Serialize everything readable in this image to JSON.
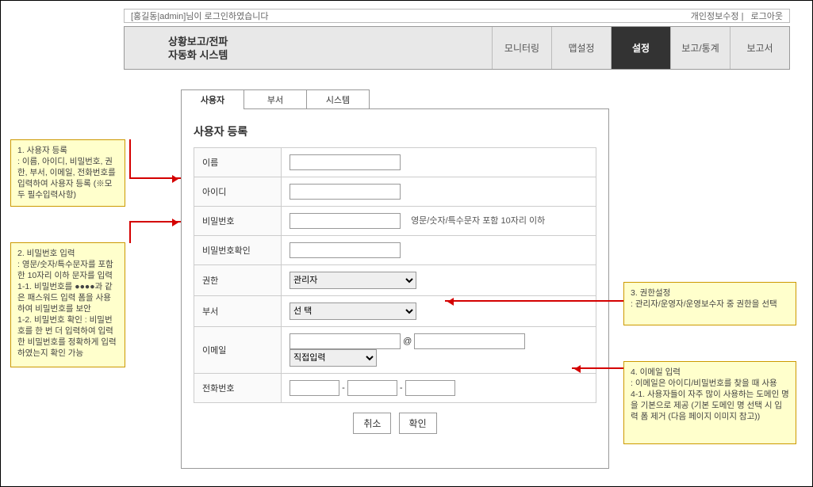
{
  "header": {
    "login_text": "[홍길동|admin]님이 로그인하였습니다",
    "profile_link": "개인정보수정",
    "logout_link": "로그아웃"
  },
  "nav": {
    "title_line1": "상황보고/전파",
    "title_line2": "자동화 시스템",
    "items": [
      "모니터링",
      "맵설정",
      "설정",
      "보고/통계",
      "보고서"
    ],
    "active_index": 2
  },
  "tabs": {
    "items": [
      "사용자",
      "부서",
      "시스템"
    ],
    "active_index": 0
  },
  "form": {
    "title": "사용자 등록",
    "labels": {
      "name": "이름",
      "id": "아이디",
      "password": "비밀번호",
      "password_confirm": "비밀번호확인",
      "role": "권한",
      "dept": "부서",
      "email": "이메일",
      "phone": "전화번호"
    },
    "password_hint": "영문/숫자/특수문자 포함 10자리 이하",
    "role_options": [
      "관리자"
    ],
    "dept_options": [
      "선 택"
    ],
    "email_at": "@",
    "email_domain_options": [
      "직접입력"
    ],
    "phone_sep": "-",
    "buttons": {
      "cancel": "취소",
      "confirm": "확인"
    }
  },
  "callouts": {
    "c1": {
      "title": "1. 사용자 등록",
      "body": " : 이름, 아이디, 비밀번호, 권한, 부서, 이메일, 전화번호를 입력하여 사용자 등록 (※모두 필수입력사항)"
    },
    "c2": {
      "title": "2. 비밀번호 입력",
      "body": " : 영문/숫자/특수문자를 포함한 10자리 이하 문자를 입력\n1-1. 비밀번호를 ●●●●과 같은 패스워드 입력 폼을 사용하여 비밀번호를 보안\n1-2. 비밀번호 확인 : 비밀번호를 한 번 더 입력하여 입력한 비밀번호를 정확하게 입력하였는지 확인 가능"
    },
    "c3": {
      "title": "3. 권한설정",
      "body": " : 관리자/운영자/운영보수자 중 권한을 선택"
    },
    "c4": {
      "title": "4. 이메일 입력",
      "body": " : 이메일은 아이디/비밀번호를 찾을 때 사용\n4-1. 사용자들이 자주 많이 사용하는 도메인 명을 기본으로 제공 (기본 도메인 명 선택 시 입력 폼 제거 (다음 페이지 이미지 참고))"
    }
  }
}
